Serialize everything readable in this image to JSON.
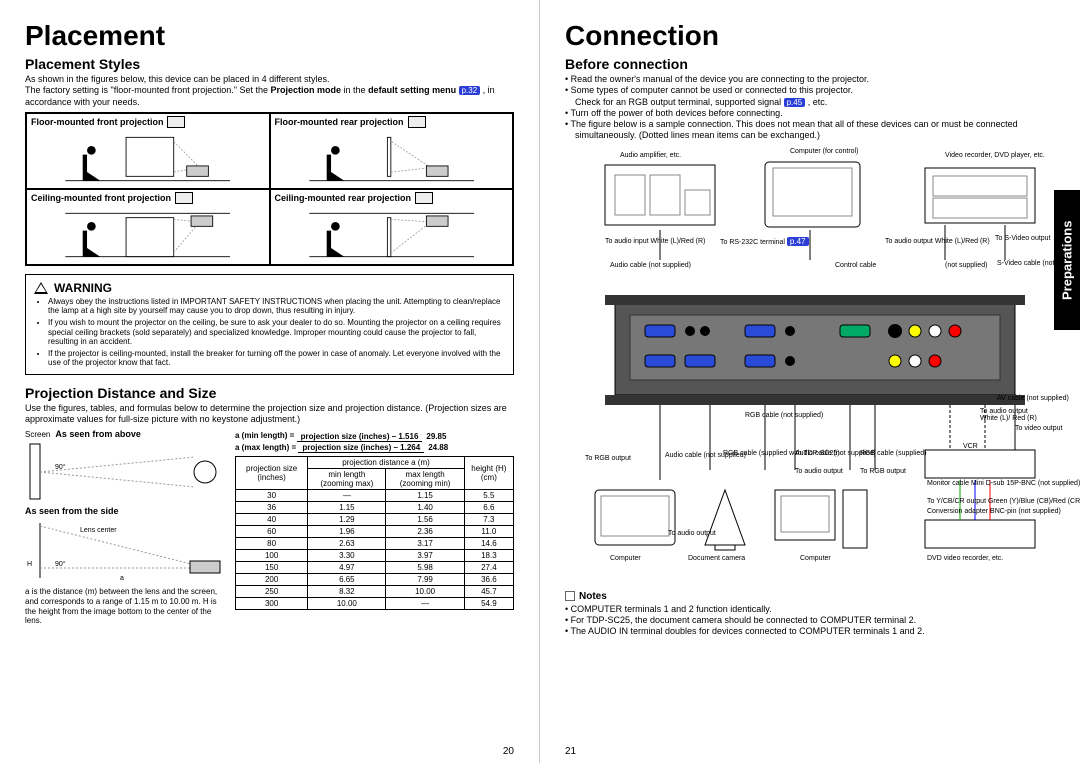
{
  "sideTab": "Preparations",
  "pageLeft": {
    "num": "20",
    "h1": "Placement",
    "styles": {
      "h2": "Placement Styles",
      "p1": "As shown in the figures below, this device can be placed in 4 different styles.",
      "p2a": "The factory setting is \"floor-mounted front projection.\" Set the ",
      "p2b": "Projection mode",
      "p2c": " in the ",
      "p2d": "default setting menu ",
      "p2ref": "p.32",
      "p2e": " , in accordance with your needs.",
      "cells": {
        "ff": "Floor-mounted front projection",
        "fr": "Floor-mounted rear projection",
        "cf": "Ceiling-mounted front projection",
        "cr": "Ceiling-mounted rear projection"
      }
    },
    "warning": {
      "title": "WARNING",
      "items": [
        "Always obey the instructions listed in IMPORTANT SAFETY INSTRUCTIONS when placing the unit. Attempting to clean/replace the lamp at a high site by yourself may cause you to drop down, thus resulting in injury.",
        "If you wish to mount the projector on the ceiling, be sure to ask your dealer to do so. Mounting the projector on a ceiling requires special ceiling brackets (sold separately) and specialized knowledge. Improper mounting could cause the projector to fall, resulting in an accident.",
        "If the projector is ceiling-mounted, install the breaker for turning off the power in case of anomaly. Let everyone involved with the use of the projector know that fact."
      ]
    },
    "dist": {
      "h2": "Projection Distance and Size",
      "p": "Use the figures, tables, and formulas below to determine the projection size and projection distance. (Projection sizes are approximate values for full-size picture with no keystone adjustment.)",
      "leftLabel1": "As seen from above",
      "leftLabel2": "As seen from the side",
      "screenLabel": "Screen",
      "lensCenter": "Lens center",
      "formulaMin": {
        "lhs": "a (min length) =",
        "num": "projection size (inches) – 1.516",
        "den": "29.85"
      },
      "formulaMax": {
        "lhs": "a (max length) =",
        "num": "projection size (inches) – 1.264",
        "den": "24.88"
      },
      "footnote": "a is the distance (m) between the lens and the screen, and corresponds to a range of 1.15 m to 10.00 m. H is the height from the image bottom to the center of the lens."
    },
    "table": {
      "h1": "projection size (inches)",
      "h2": "projection distance a (m)",
      "h2a": "min length (zooming max)",
      "h2b": "max length (zooming min)",
      "h3": "height (H) (cm)",
      "rows": [
        [
          "30",
          "—",
          "1.15",
          "5.5"
        ],
        [
          "36",
          "1.15",
          "1.40",
          "6.6"
        ],
        [
          "40",
          "1.29",
          "1.56",
          "7.3"
        ],
        [
          "60",
          "1.96",
          "2.36",
          "11.0"
        ],
        [
          "80",
          "2.63",
          "3.17",
          "14.6"
        ],
        [
          "100",
          "3.30",
          "3.97",
          "18.3"
        ],
        [
          "150",
          "4.97",
          "5.98",
          "27.4"
        ],
        [
          "200",
          "6.65",
          "7.99",
          "36.6"
        ],
        [
          "250",
          "8.32",
          "10.00",
          "45.7"
        ],
        [
          "300",
          "10.00",
          "—",
          "54.9"
        ]
      ]
    }
  },
  "pageRight": {
    "num": "21",
    "h1": "Connection",
    "before": {
      "h2": "Before connection",
      "items": [
        {
          "t": "Read the owner's manual of the device you are connecting to the projector."
        },
        {
          "t": "Some types of computer cannot be used or connected to this projector.",
          "sub": "Check for an RGB output terminal, supported signal ",
          "ref": "p.45",
          "subEnd": " , etc."
        },
        {
          "t": "Turn off the power of both devices before connecting."
        },
        {
          "t": "The figure below is a sample connection. This does not mean that all of these devices can or must be connected simultaneously. (Dotted lines mean items can be exchanged.)"
        }
      ]
    },
    "diagramLabels": {
      "amp": "Audio amplifier, etc.",
      "compCtrl": "Computer (for control)",
      "vcr": "Video recorder, DVD player, etc.",
      "toAudioInL": "To audio input White (L)/Red (R)",
      "rs232": "To RS-232C terminal",
      "rs232ref": "p.47",
      "toAudioOutL": "To audio output White (L)/Red (R)",
      "toSVideo": "To S-Video output",
      "audioCableNS": "Audio cable (not supplied)",
      "controlCable": "Control cable",
      "notSupplied": "(not supplied)",
      "sVideoCable": "S-Video cable (not supplied)",
      "rgbCableNS": "RGB cable (not supplied)",
      "toAudioOut": "To audio output",
      "whiteRed": "White (L)/ Red (R)",
      "toVideoOut": "To video output",
      "avCable": "AV cable (not supplied)",
      "toRGBOut": "To RGB output",
      "audioCableSup": "Audio cable (not supplied)",
      "rgbSupplied": "RGB cable (supplied with TDP-SC25)",
      "rgbSupplied2": "RGB cable (supplied)",
      "toRGB": "To RGB output",
      "compBottom": "Computer",
      "docCam": "Document camera",
      "dvdVcr": "DVD video recorder, etc.",
      "vcrLabel": "VCR",
      "monitorCable": "Monitor cable Mini D-sub 15P-BNC (not supplied)",
      "toYCbCr": "To Y/CB/CR output Green (Y)/Blue (CB)/Red (CR)",
      "bncAdapter": "Conversion adapter BNC-pin (not supplied)"
    },
    "notes": {
      "h": "Notes",
      "items": [
        "COMPUTER terminals 1 and 2 function identically.",
        "For TDP-SC25, the document camera should be connected to COMPUTER terminal 2.",
        "The AUDIO IN terminal doubles for devices connected to COMPUTER terminals 1 and 2."
      ]
    }
  }
}
